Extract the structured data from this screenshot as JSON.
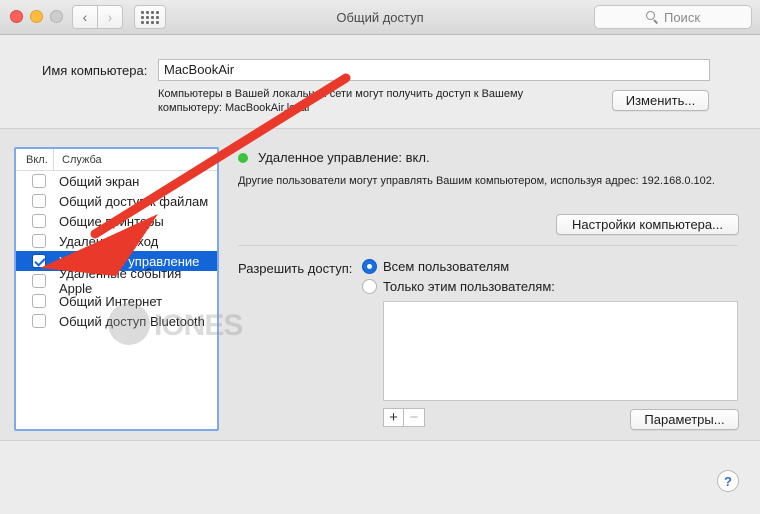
{
  "window": {
    "title": "Общий доступ",
    "search_placeholder": "Поиск"
  },
  "computer_name": {
    "label": "Имя компьютера:",
    "value": "MacBookAir",
    "note_line1": "Компьютеры в Вашей локальной сети могут получить доступ к Вашему",
    "note_line2": "компьютеру: MacBookAir.local",
    "change_button": "Изменить..."
  },
  "services": {
    "header_on": "Вкл.",
    "header_service": "Служба",
    "items": [
      {
        "label": "Общий экран",
        "checked": false,
        "selected": false
      },
      {
        "label": "Общий доступ к файлам",
        "checked": false,
        "selected": false
      },
      {
        "label": "Общие принтеры",
        "checked": false,
        "selected": false
      },
      {
        "label": "Удаленный вход",
        "checked": false,
        "selected": false
      },
      {
        "label": "Удаленное управление",
        "checked": true,
        "selected": true
      },
      {
        "label": "Удаленные события Apple",
        "checked": false,
        "selected": false
      },
      {
        "label": "Общий Интернет",
        "checked": false,
        "selected": false
      },
      {
        "label": "Общий доступ Bluetooth",
        "checked": false,
        "selected": false
      }
    ]
  },
  "detail": {
    "status": "Удаленное управление: вкл.",
    "status_color": "#3cc23c",
    "description": "Другие пользователи могут управлять Вашим компьютером, используя адрес: 192.168.0.102.",
    "settings_button": "Настройки компьютера...",
    "access_label": "Разрешить доступ:",
    "radio_all": "Всем пользователям",
    "radio_only": "Только этим пользователям:",
    "add_symbol": "+",
    "remove_symbol": "−",
    "params_button": "Параметры..."
  },
  "help_symbol": "?",
  "watermark_text": "IONES",
  "colors": {
    "selection": "#1466d8",
    "annotation_arrow": "#e8392b"
  }
}
